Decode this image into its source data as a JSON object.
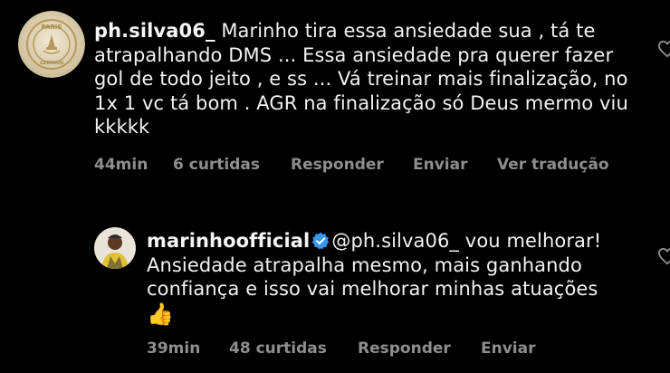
{
  "comments": [
    {
      "username": "ph.silva06_",
      "text": "Marinho tira essa ansiedade sua , tá te atrapalhando DMS ... Essa ansiedade pra querer fazer gol de todo jeito , e ss ... Vá treinar mais finalização, no 1x 1 vc tá bom . AGR na finalização só Deus mermo viu kkkkk",
      "time": "44min",
      "likes": "6 curtidas",
      "reply_label": "Responder",
      "send_label": "Enviar",
      "translate_label": "Ver tradução",
      "avatar_text_top": "PARIS",
      "avatar_text_bottom": "GERMAIN"
    },
    {
      "username": "marinhoofficial",
      "mention": "@ph.silva06_",
      "text_line1": " vou melhorar!",
      "text": "Ansiedade atrapalha mesmo, mais ganhando confiança e isso vai melhorar minhas atuações",
      "emoji": "👍",
      "time": "39min",
      "likes": "48 curtidas",
      "reply_label": "Responder",
      "send_label": "Enviar"
    }
  ],
  "colors": {
    "background": "#000000",
    "text": "#f2f2f2",
    "secondary": "#8e8e8e",
    "verified": "#3897f0"
  },
  "icons": [
    "psg-crest-avatar",
    "user-avatar",
    "verified-icon",
    "heart-icon"
  ]
}
